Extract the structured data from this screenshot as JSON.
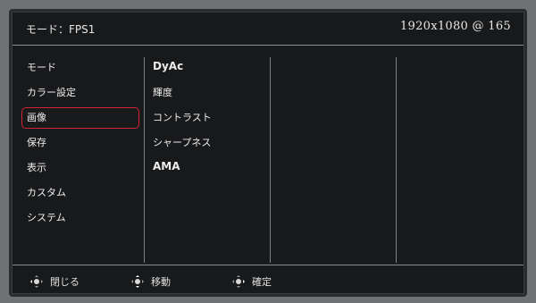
{
  "header": {
    "mode_title": "モード：FPS1",
    "resolution": "1920x1080 @ 165"
  },
  "sidebar": {
    "items": [
      {
        "label": "モード"
      },
      {
        "label": "カラー設定"
      },
      {
        "label": "画像",
        "active": true
      },
      {
        "label": "保存"
      },
      {
        "label": "表示"
      },
      {
        "label": "カスタム"
      },
      {
        "label": "システム"
      }
    ]
  },
  "submenu": {
    "items": [
      {
        "label": "DyAc"
      },
      {
        "label": "輝度"
      },
      {
        "label": "コントラスト"
      },
      {
        "label": "シャープネス"
      },
      {
        "label": "AMA"
      }
    ]
  },
  "footer": {
    "close_label": "閉じる",
    "move_label": "移動",
    "confirm_label": "確定"
  },
  "colors": {
    "active_outline": "#d0243b",
    "background": "#18191b",
    "divider": "#8b8d90"
  }
}
